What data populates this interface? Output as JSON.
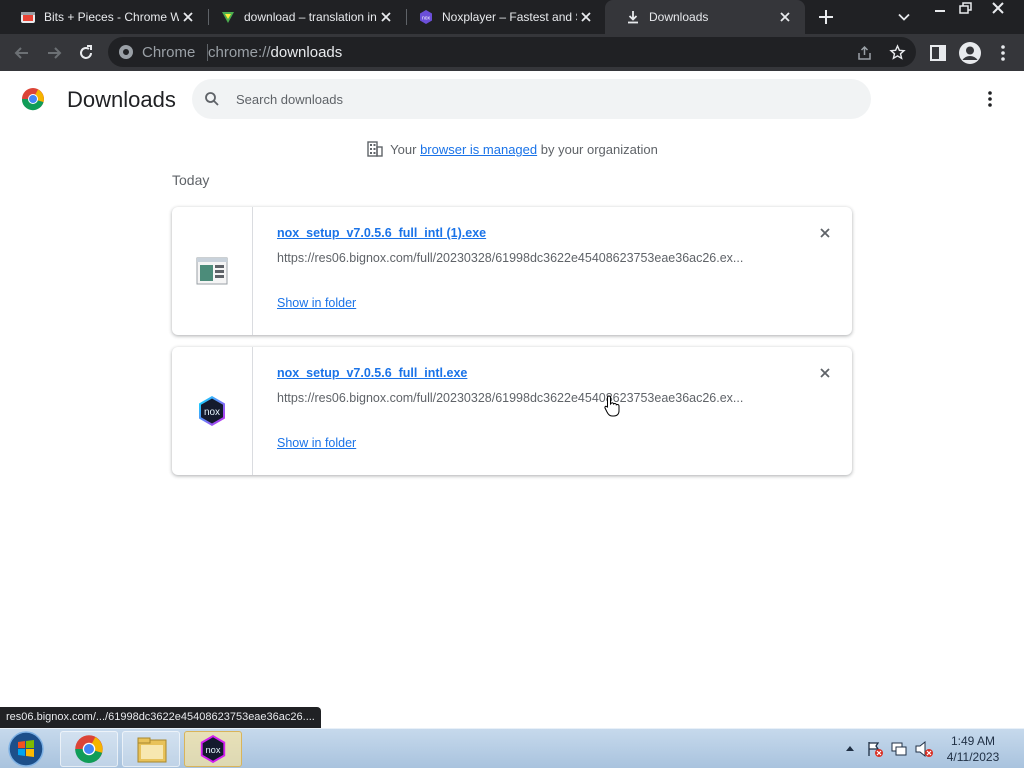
{
  "tabs": [
    {
      "title": "Bits + Pieces - Chrome Web Store",
      "icon": "puzzle-icon"
    },
    {
      "title": "download – translation in Spanish",
      "icon": "translate-icon"
    },
    {
      "title": "Noxplayer – Fastest and Smoothest",
      "icon": "nox-icon"
    },
    {
      "title": "Downloads",
      "icon": "download-icon",
      "active": true
    }
  ],
  "omnibox": {
    "scheme_label": "Chrome",
    "url_prefix": "chrome://",
    "url_host": "downloads"
  },
  "page": {
    "title": "Downloads",
    "search_placeholder": "Search downloads",
    "managed_prefix": "Your",
    "managed_link": "browser is managed",
    "managed_suffix": "by your organization",
    "section": "Today"
  },
  "downloads": [
    {
      "filename": "nox_setup_v7.0.5.6_full_intl (1).exe",
      "url": "https://res06.bignox.com/full/20230328/61998dc3622e45408623753eae36ac26.ex...",
      "action": "Show in folder",
      "icon": "exe-file-icon"
    },
    {
      "filename": "nox_setup_v7.0.5.6_full_intl.exe",
      "url": "https://res06.bignox.com/full/20230328/61998dc3622e45408623753eae36ac26.ex...",
      "action": "Show in folder",
      "icon": "nox-app-icon"
    }
  ],
  "status_bar": "res06.bignox.com/.../61998dc3622e45408623753eae36ac26....",
  "taskbar": {
    "time": "1:49 AM",
    "date": "4/11/2023"
  },
  "colors": {
    "link": "#1a73e8",
    "chrome_dark": "#202124",
    "toolbar": "#35363a"
  }
}
